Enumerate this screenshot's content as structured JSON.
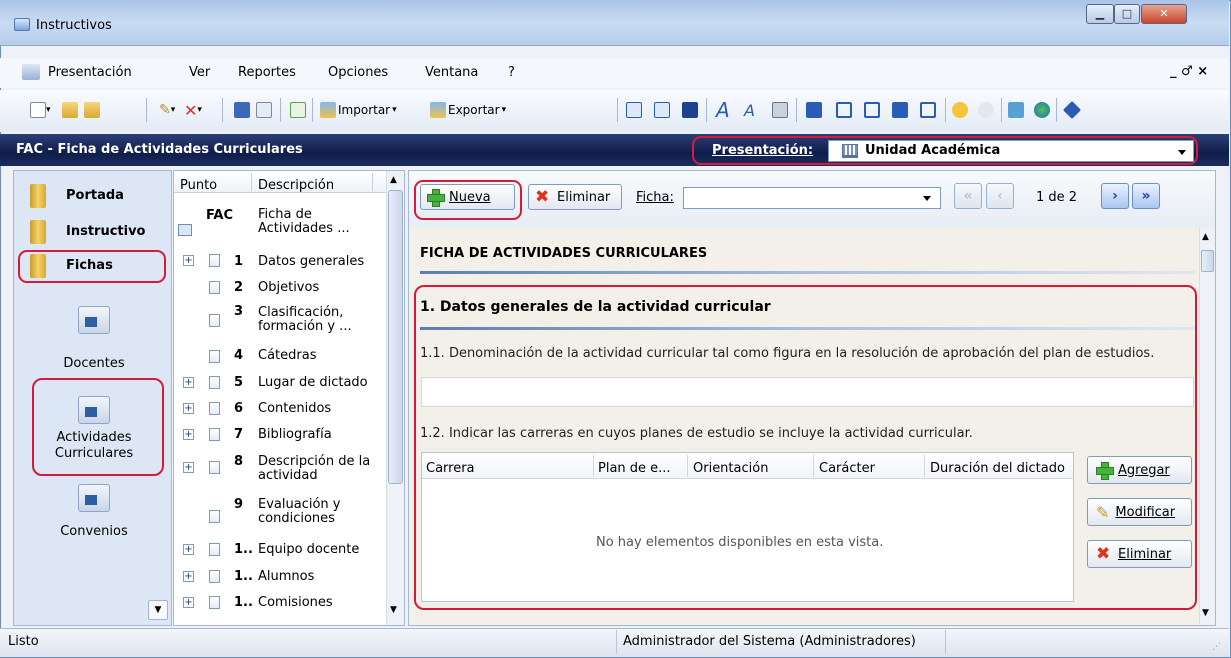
{
  "window": {
    "title": "Instructivos"
  },
  "menu": {
    "items": [
      "Presentación",
      "Ver",
      "Reportes",
      "Opciones",
      "Ventana",
      "?"
    ],
    "mdi_controls": "_ ♂ ×"
  },
  "toolbar": {
    "import_label": "Importar",
    "export_label": "Exportar"
  },
  "header": {
    "title": "FAC - Ficha de Actividades Curriculares",
    "presentation_label": "Presentación:",
    "presentation_value": "Unidad Académica"
  },
  "sidebar": {
    "items": [
      {
        "label": "Portada"
      },
      {
        "label": "Instructivo"
      },
      {
        "label": "Fichas"
      }
    ],
    "nav": [
      {
        "label": "Docentes"
      },
      {
        "label": "Actividades Curriculares"
      },
      {
        "label": "Convenios"
      }
    ]
  },
  "tree": {
    "headers": [
      "Punto",
      "Descripción"
    ],
    "rows": [
      {
        "num": "FAC",
        "desc": "Ficha de Actividades ..."
      },
      {
        "num": "1",
        "desc": "Datos generales"
      },
      {
        "num": "2",
        "desc": "Objetivos"
      },
      {
        "num": "3",
        "desc": "Clasificación, formación y ..."
      },
      {
        "num": "4",
        "desc": "Cátedras"
      },
      {
        "num": "5",
        "desc": "Lugar de dictado"
      },
      {
        "num": "6",
        "desc": "Contenidos"
      },
      {
        "num": "7",
        "desc": "Bibliografía"
      },
      {
        "num": "8",
        "desc": "Descripción de la actividad"
      },
      {
        "num": "9",
        "desc": "Evaluación y condiciones"
      },
      {
        "num": "1..",
        "desc": "Equipo docente"
      },
      {
        "num": "1..",
        "desc": "Alumnos"
      },
      {
        "num": "1..",
        "desc": "Comisiones"
      }
    ]
  },
  "actions": {
    "new_label": "Nueva",
    "delete_label": "Eliminar",
    "ficha_label": "Ficha:",
    "page_indicator": "1 de 2"
  },
  "form": {
    "main_title": "FICHA DE ACTIVIDADES CURRICULARES",
    "section1_title": "1. Datos generales de la actividad curricular",
    "q1": "1.1. Denominación de la actividad curricular tal como figura en la resolución de aprobación del plan de estudios.",
    "q2": "1.2. Indicar las carreras en cuyos planes de estudio se incluye la actividad curricular.",
    "grid_columns": [
      "Carrera",
      "Plan de e...",
      "Orientación",
      "Carácter",
      "Duración del dictado"
    ],
    "grid_empty": "No hay elementos disponibles en esta vista.",
    "add_label": "Agregar",
    "modify_label": "Modificar",
    "remove_label": "Eliminar"
  },
  "status": {
    "left": "Listo",
    "user": "Administrador del Sistema (Administradores)"
  },
  "colors": {
    "highlight": "#d81a3a",
    "header_bg": "#101d4a",
    "add_green": "#46b43c",
    "delete_red": "#e0321e"
  }
}
